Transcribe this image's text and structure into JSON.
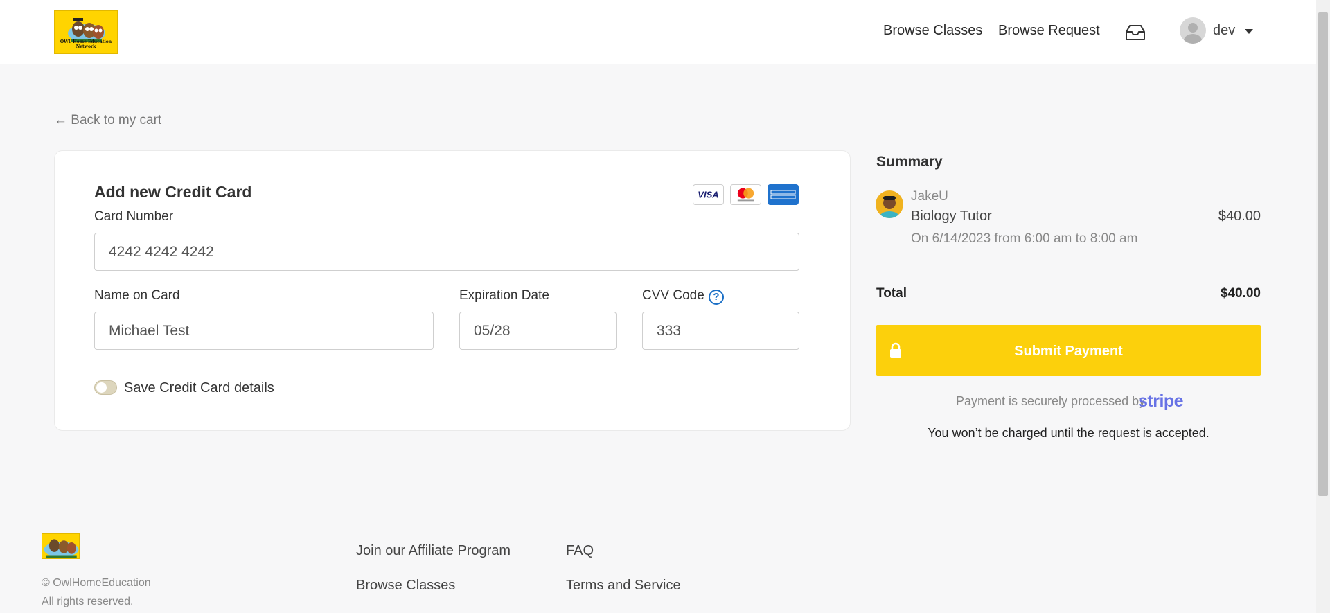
{
  "header": {
    "logo_text": "OWL Home Education Network",
    "nav": {
      "browse_classes": "Browse Classes",
      "browse_request": "Browse Request"
    },
    "user": {
      "name": "dev"
    }
  },
  "back_link": "← Back to my cart",
  "card_form": {
    "title": "Add new Credit Card",
    "brands": [
      "Visa",
      "Mastercard",
      "American Express"
    ],
    "card_number": {
      "label": "Card Number",
      "value": "4242 4242 4242"
    },
    "name_on_card": {
      "label": "Name on Card",
      "value": "Michael Test"
    },
    "expiration": {
      "label": "Expiration Date",
      "value": "05/28"
    },
    "cvv": {
      "label": "CVV Code",
      "value": "333",
      "help": "?"
    },
    "save_toggle": {
      "label": "Save Credit Card details",
      "checked": false
    }
  },
  "summary": {
    "title": "Summary",
    "item": {
      "tutor": "JakeU",
      "title": "Biology Tutor",
      "price": "$40.00",
      "date": "On 6/14/2023 from 6:00 am to 8:00 am"
    },
    "total_label": "Total",
    "total_value": "$40.00",
    "submit_label": "Submit Payment",
    "secure_text": "Payment is securely processed by",
    "stripe": "stripe",
    "charge_note": "You won’t be charged until the request is accepted."
  },
  "footer": {
    "copyright": "© OwlHomeEducation",
    "rights": "All rights reserved.",
    "links": {
      "affiliate": "Join our Affiliate Program",
      "faq": "FAQ",
      "browse_classes": "Browse Classes",
      "terms": "Terms and Service"
    }
  },
  "colors": {
    "accent_yellow": "#fcd00c",
    "stripe_purple": "#6772e5",
    "help_blue": "#1a6fc6"
  }
}
